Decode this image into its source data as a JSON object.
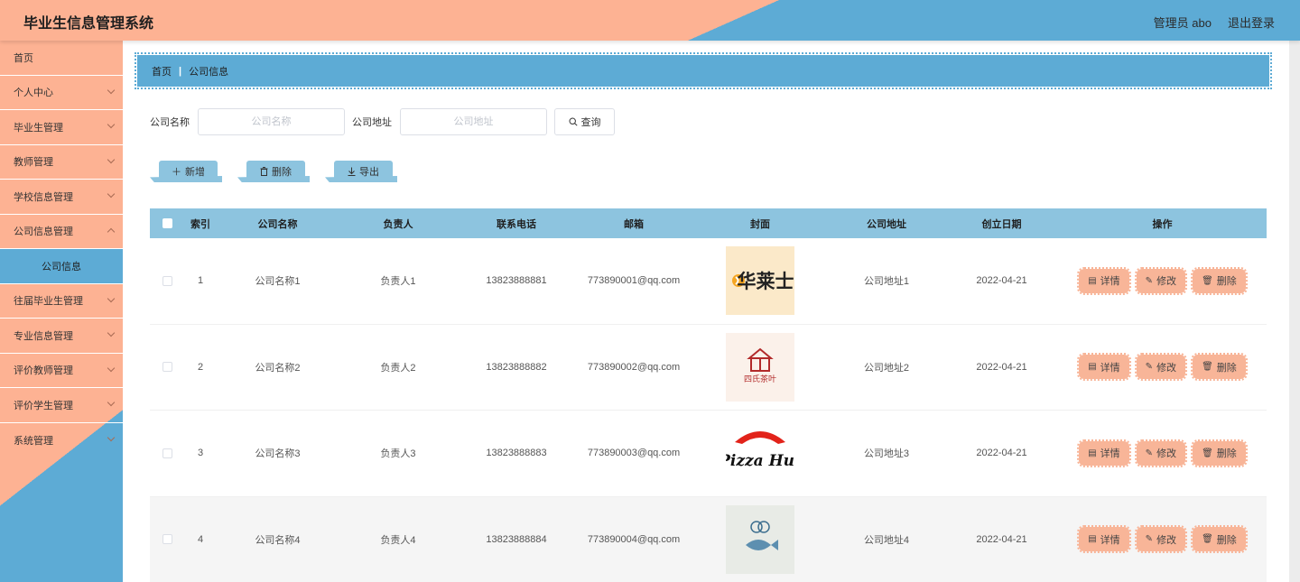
{
  "header": {
    "title": "毕业生信息管理系统",
    "user": "管理员 abo",
    "logout": "退出登录"
  },
  "sidebar": {
    "items": [
      {
        "label": "首页"
      },
      {
        "label": "个人中心"
      },
      {
        "label": "毕业生管理"
      },
      {
        "label": "教师管理"
      },
      {
        "label": "学校信息管理"
      },
      {
        "label": "公司信息管理"
      },
      {
        "label": "公司信息"
      },
      {
        "label": "往届毕业生管理"
      },
      {
        "label": "专业信息管理"
      },
      {
        "label": "评价教师管理"
      },
      {
        "label": "评价学生管理"
      },
      {
        "label": "系统管理"
      }
    ]
  },
  "breadcrumb": {
    "home": "首页",
    "current": "公司信息"
  },
  "search": {
    "name_label": "公司名称",
    "name_placeholder": "公司名称",
    "addr_label": "公司地址",
    "addr_placeholder": "公司地址",
    "button": "查询"
  },
  "actions": {
    "add": "新增",
    "delete": "删除",
    "export": "导出"
  },
  "table": {
    "headers": [
      "索引",
      "公司名称",
      "负责人",
      "联系电话",
      "邮箱",
      "封面",
      "公司地址",
      "创立日期",
      "操作"
    ],
    "rows": [
      {
        "idx": "1",
        "name": "公司名称1",
        "owner": "负责人1",
        "phone": "13823888881",
        "email": "773890001@qq.com",
        "cover": "华莱士",
        "address": "公司地址1",
        "date": "2022-04-21"
      },
      {
        "idx": "2",
        "name": "公司名称2",
        "owner": "负责人2",
        "phone": "13823888882",
        "email": "773890002@qq.com",
        "cover": "四氏茶叶",
        "address": "公司地址2",
        "date": "2022-04-21"
      },
      {
        "idx": "3",
        "name": "公司名称3",
        "owner": "负责人3",
        "phone": "13823888883",
        "email": "773890003@qq.com",
        "cover": "Pizza Hut",
        "address": "公司地址3",
        "date": "2022-04-21"
      },
      {
        "idx": "4",
        "name": "公司名称4",
        "owner": "负责人4",
        "phone": "13823888884",
        "email": "773890004@qq.com",
        "cover": "",
        "address": "公司地址4",
        "date": "2022-04-21"
      }
    ],
    "ops": {
      "detail": "详情",
      "edit": "修改",
      "delete": "删除"
    }
  },
  "colors": {
    "peach": "#fdb293",
    "blue": "#5dabd5",
    "light_blue": "#8dc4df",
    "op_button": "#f8b598"
  }
}
